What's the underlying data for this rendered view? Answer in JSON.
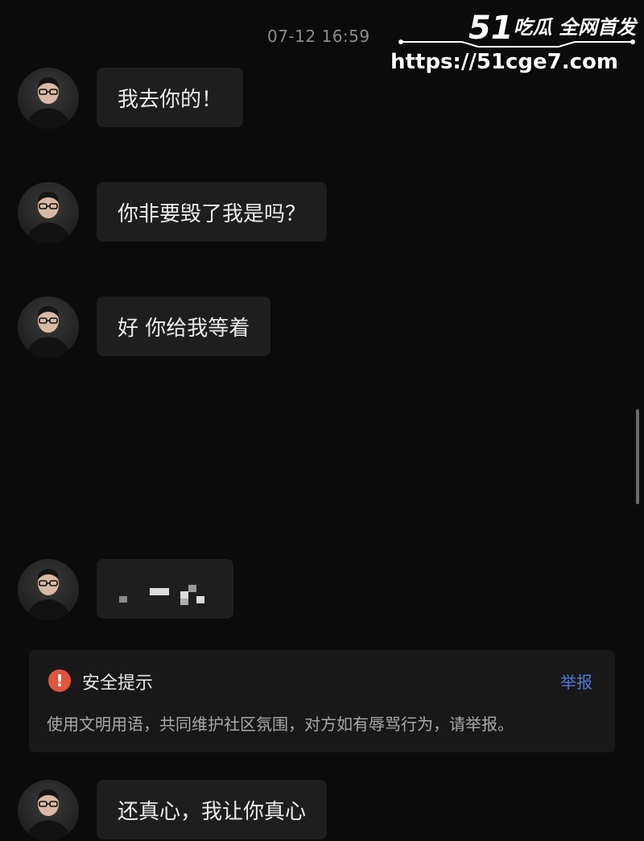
{
  "timestamp": "07-12 16:59",
  "watermark": {
    "brand_num": "51",
    "brand_text": "吃瓜 全网首发",
    "url": "https://51cge7.com"
  },
  "messages": [
    {
      "text": "我去你的！"
    },
    {
      "text": "你非要毁了我是吗？"
    },
    {
      "text": "好 你给我等着"
    },
    {
      "text": "",
      "pixelated": true
    },
    {
      "text": "还真心，我让你真心"
    }
  ],
  "safety_notice": {
    "icon": "warning-icon",
    "icon_glyph": "!",
    "title": "安全提示",
    "report_label": "举报",
    "body": "使用文明用语，共同维护社区氛围，对方如有辱骂行为，请举报。"
  },
  "colors": {
    "background": "#0b0b0b",
    "bubble": "#1e1e1e",
    "warning": "#e2543c",
    "report_link": "#4f7bd9"
  }
}
